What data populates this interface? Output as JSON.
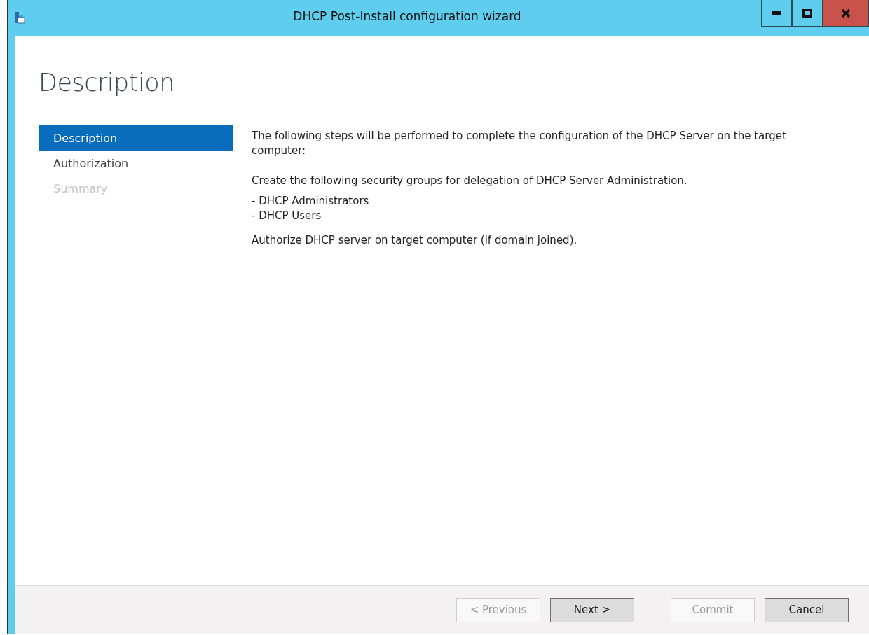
{
  "window": {
    "title": "DHCP Post-Install configuration wizard"
  },
  "page_title": "Description",
  "steps": [
    {
      "label": "Description",
      "selected": true,
      "disabled": false
    },
    {
      "label": "Authorization",
      "selected": false,
      "disabled": false
    },
    {
      "label": "Summary",
      "selected": false,
      "disabled": true
    }
  ],
  "content": [
    {
      "kind": "para",
      "text": "The following steps will be performed to complete the configuration of the DHCP Server on the target computer:"
    },
    {
      "kind": "para",
      "text": "Create the following security groups for delegation of DHCP Server Administration."
    },
    {
      "kind": "item",
      "text": "- DHCP Administrators"
    },
    {
      "kind": "item",
      "text": "- DHCP Users"
    },
    {
      "kind": "para",
      "text": "Authorize DHCP server on target computer (if domain joined)."
    }
  ],
  "buttons": [
    {
      "label": "< Previous",
      "disabled": true
    },
    {
      "label": "Next >",
      "disabled": false
    },
    {
      "label": "Commit",
      "disabled": true
    },
    {
      "label": "Cancel",
      "disabled": false
    }
  ]
}
